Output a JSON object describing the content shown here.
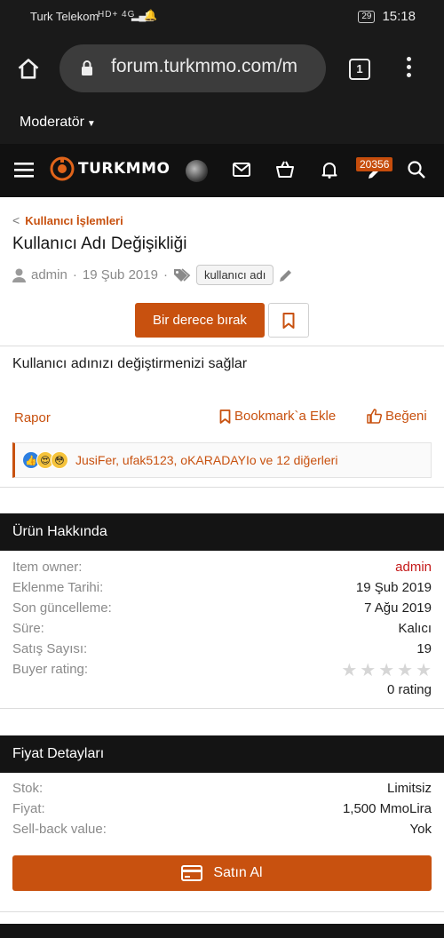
{
  "status_bar": {
    "carrier": "Turk Telekom",
    "network": "HD+ 4G",
    "battery": "29",
    "time": "15:18"
  },
  "browser": {
    "url": "forum.turkmmo.com/m",
    "tab_count": "1"
  },
  "moderator_menu": {
    "label": "Moderatör"
  },
  "nav": {
    "logo_text": "TURKMMO",
    "notification_count": "20356"
  },
  "breadcrumb": {
    "label": "Kullanıcı İşlemleri"
  },
  "page": {
    "title": "Kullanıcı Adı Değişikliği",
    "author": "admin",
    "date": "19 Şub 2019",
    "tag": "kullanıcı adı",
    "rate_button": "Bir derece bırak",
    "description": "Kullanıcı adınızı değiştirmenizi sağlar"
  },
  "actions": {
    "report": "Rapor",
    "bookmark": "Bookmark`a Ekle",
    "like": "Beğeni"
  },
  "reactions": {
    "users": "JusiFer, ufak5123, oKARADAYIo ve 12 diğerleri"
  },
  "product_info": {
    "heading": "Ürün Hakkında",
    "rows": [
      {
        "key": "Item owner:",
        "value": "admin"
      },
      {
        "key": "Eklenme Tarihi:",
        "value": "19 Şub 2019"
      },
      {
        "key": "Son güncelleme:",
        "value": "7 Ağu 2019"
      },
      {
        "key": "Süre:",
        "value": "Kalıcı"
      },
      {
        "key": "Satış Sayısı:",
        "value": "19"
      },
      {
        "key": "Buyer rating:",
        "value": ""
      }
    ],
    "rating_count": "0 rating",
    "rating_stars": 0
  },
  "price_details": {
    "heading": "Fiyat Detayları",
    "rows": [
      {
        "key": "Stok:",
        "value": "Limitsiz"
      },
      {
        "key": "Fiyat:",
        "value": "1,500 MmoLira"
      },
      {
        "key": "Sell-back value:",
        "value": "Yok"
      }
    ],
    "buy_button": "Satın Al"
  },
  "colors": {
    "accent": "#c8510f",
    "dark_bg": "#141414",
    "owner_red": "#c41818"
  }
}
